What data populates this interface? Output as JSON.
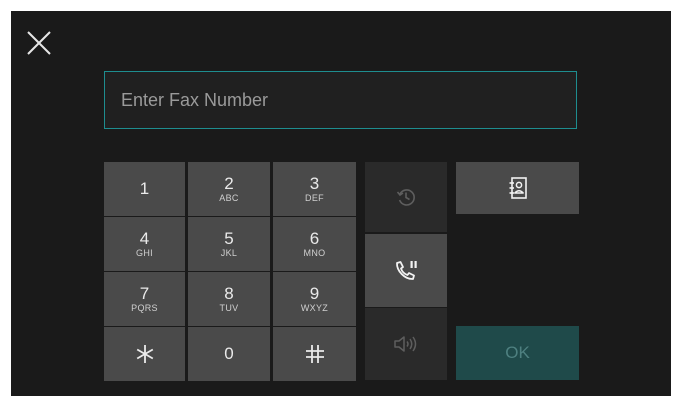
{
  "input": {
    "placeholder": "Enter Fax Number"
  },
  "keypad": {
    "keys": [
      {
        "digit": "1",
        "letters": ""
      },
      {
        "digit": "2",
        "letters": "ABC"
      },
      {
        "digit": "3",
        "letters": "DEF"
      },
      {
        "digit": "4",
        "letters": "GHI"
      },
      {
        "digit": "5",
        "letters": "JKL"
      },
      {
        "digit": "6",
        "letters": "MNO"
      },
      {
        "digit": "7",
        "letters": "PQRS"
      },
      {
        "digit": "8",
        "letters": "TUV"
      },
      {
        "digit": "9",
        "letters": "WXYZ"
      },
      {
        "digit": "*",
        "letters": ""
      },
      {
        "digit": "0",
        "letters": ""
      },
      {
        "digit": "#",
        "letters": ""
      }
    ]
  },
  "buttons": {
    "ok_label": "OK"
  },
  "icons": {
    "close": "close-icon",
    "redial": "redial-icon",
    "on_hook": "on-hook-dial-icon",
    "speaker": "speaker-icon",
    "address_book": "address-book-icon"
  },
  "colors": {
    "background": "#1a1a1a",
    "key": "#4a4a4a",
    "input_border": "#1e8d8f",
    "ok_disabled": "#1f4a4a"
  }
}
